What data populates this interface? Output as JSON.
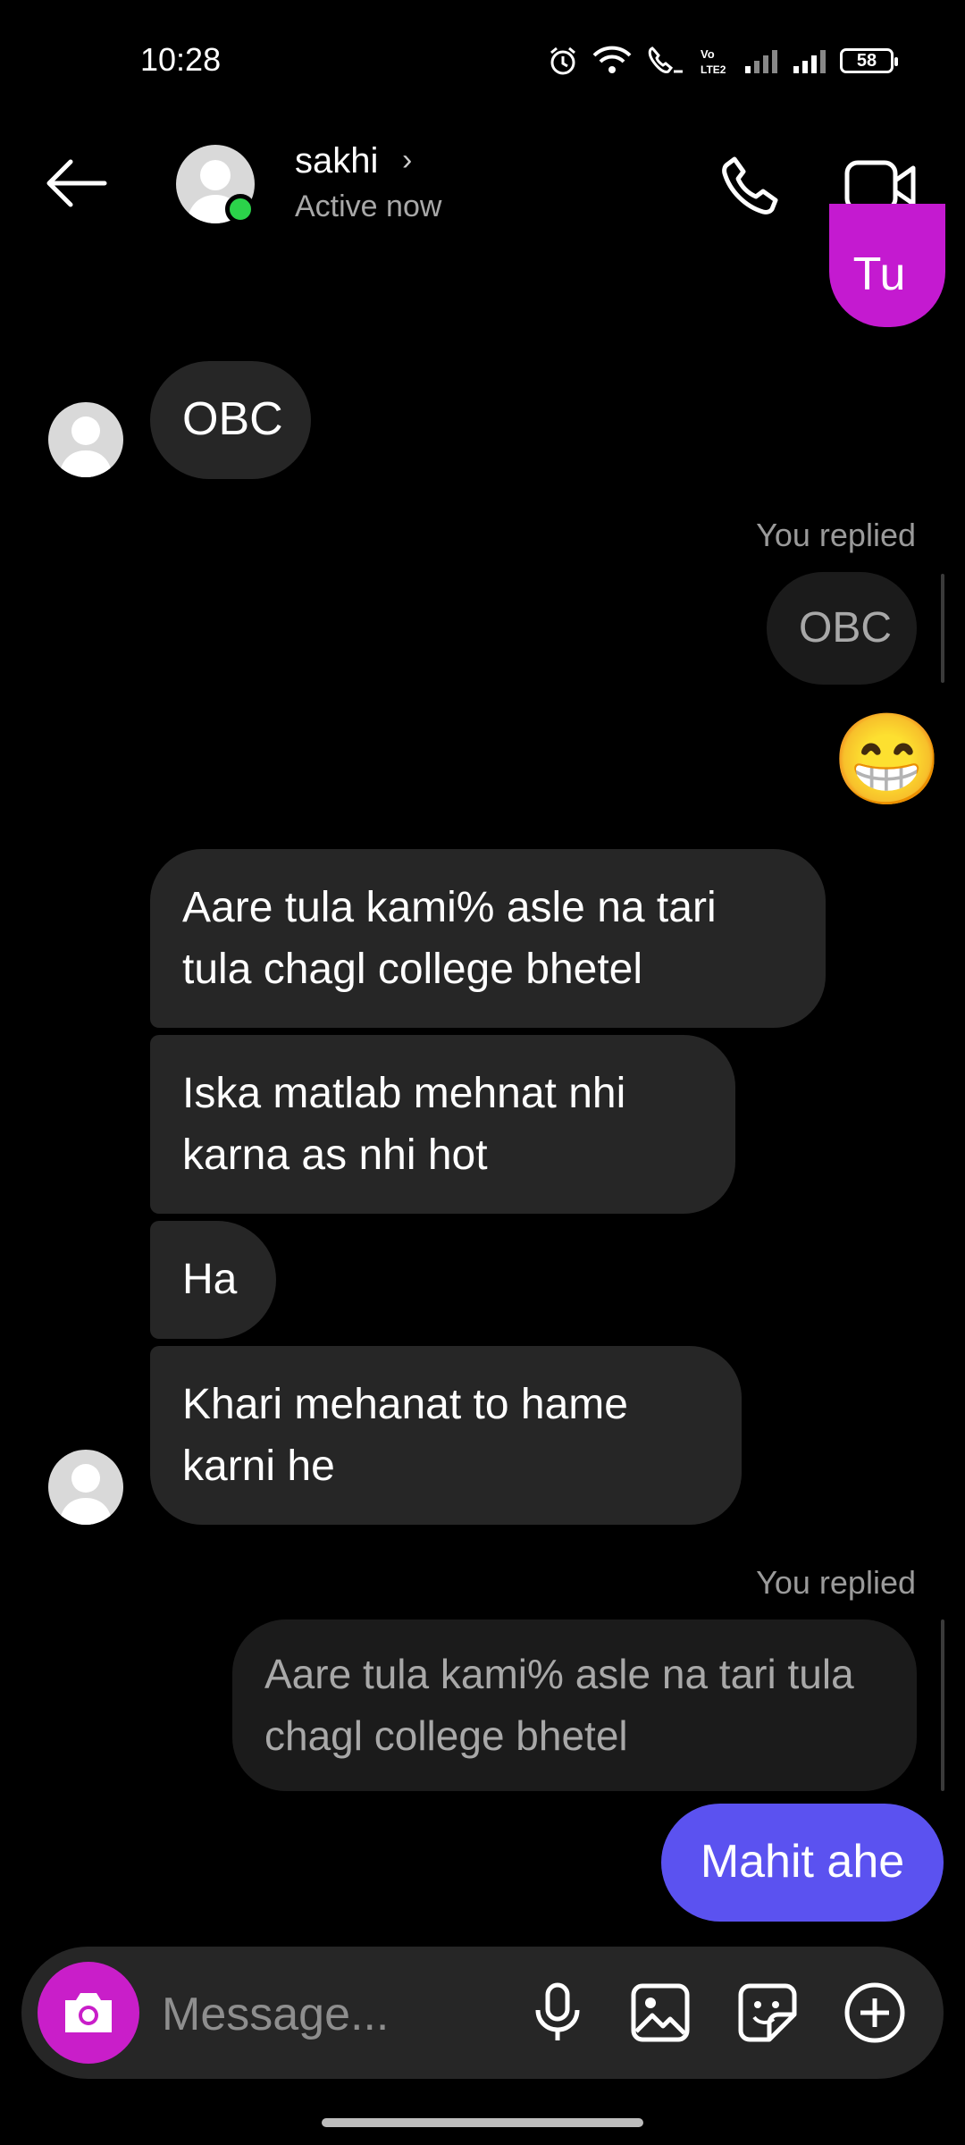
{
  "status_bar": {
    "time": "10:28",
    "battery": "58"
  },
  "header": {
    "name": "sakhi",
    "status": "Active now"
  },
  "messages": {
    "top_partial": "Tu",
    "obc_incoming": "OBC",
    "reply1_label": "You replied",
    "reply1_quote": "OBC",
    "emoji": "😁",
    "in1": "Aare tula kami% asle na tari tula chagl college bhetel",
    "in2": "Iska matlab mehnat nhi karna as nhi hot",
    "in3": "Ha",
    "in4": "Khari mehanat to hame karni he",
    "reply2_label": "You replied",
    "reply2_quote": "Aare tula kami% asle na tari tula chagl college bhetel",
    "out_last": "Mahit ahe"
  },
  "composer": {
    "placeholder": "Message..."
  },
  "colors": {
    "outgoing_purple": "#5b52f0",
    "outgoing_magenta": "#c41ad0",
    "incoming": "#262626",
    "online": "#2bd34a"
  }
}
